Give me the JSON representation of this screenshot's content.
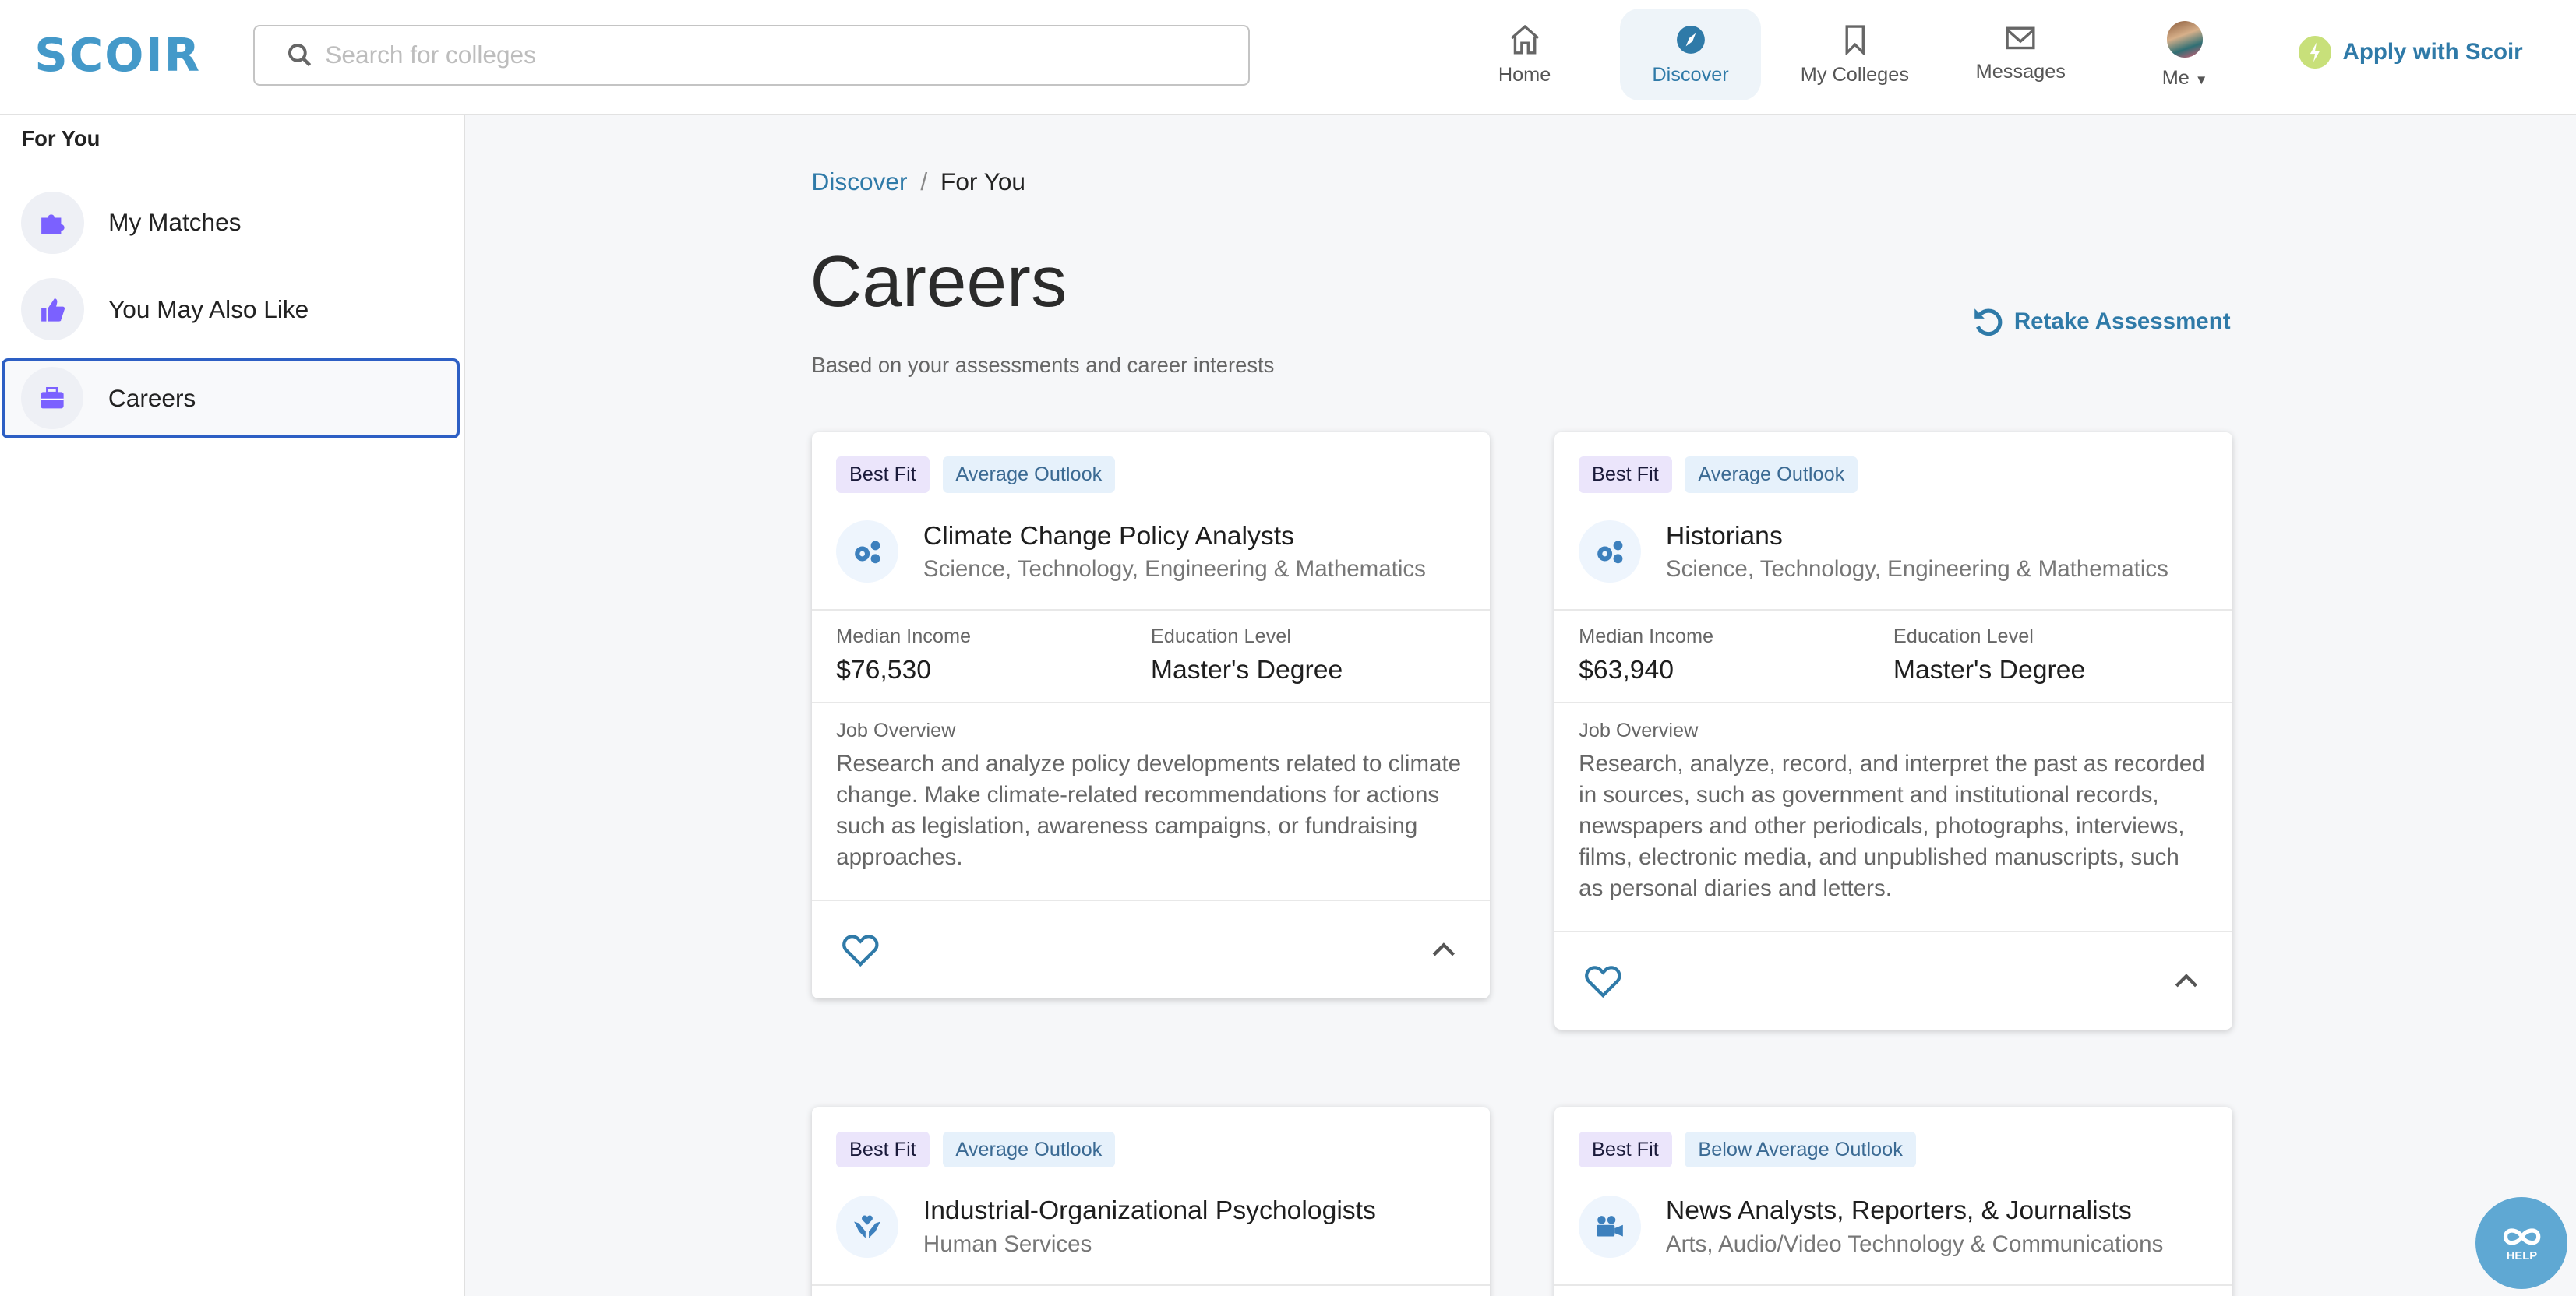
{
  "header": {
    "logo": "SCOIR",
    "search_placeholder": "Search for colleges",
    "nav": [
      {
        "label": "Home",
        "icon": "home-icon"
      },
      {
        "label": "Discover",
        "icon": "compass-icon",
        "active": true
      },
      {
        "label": "My Colleges",
        "icon": "bookmark-icon"
      },
      {
        "label": "Messages",
        "icon": "envelope-icon"
      },
      {
        "label": "Me",
        "icon": "avatar"
      }
    ],
    "apply_label": "Apply with Scoir"
  },
  "sidebar": {
    "title": "For You",
    "items": [
      {
        "label": "My Matches",
        "icon": "puzzle-icon"
      },
      {
        "label": "You May Also Like",
        "icon": "thumbs-up-icon"
      },
      {
        "label": "Careers",
        "icon": "briefcase-icon",
        "selected": true
      }
    ]
  },
  "breadcrumb": {
    "parent": "Discover",
    "separator": "/",
    "current": "For You"
  },
  "page": {
    "title": "Careers",
    "subtitle": "Based on your assessments and career interests",
    "retake_label": "Retake Assessment"
  },
  "labels": {
    "median_income": "Median Income",
    "education_level": "Education Level",
    "job_overview": "Job Overview"
  },
  "cards": [
    {
      "fit": "Best Fit",
      "outlook": "Average Outlook",
      "title": "Climate Change Policy Analysts",
      "category": "Science, Technology, Engineering & Mathematics",
      "icon": "gears-icon",
      "income": "$76,530",
      "education": "Master's Degree",
      "overview": "Research and analyze policy developments related to climate change. Make climate-related recommendations for actions such as legislation, awareness campaigns, or fundraising approaches."
    },
    {
      "fit": "Best Fit",
      "outlook": "Average Outlook",
      "title": "Historians",
      "category": "Science, Technology, Engineering & Mathematics",
      "icon": "gears-icon",
      "income": "$63,940",
      "education": "Master's Degree",
      "overview": "Research, analyze, record, and interpret the past as recorded in sources, such as government and institutional records, newspapers and other periodicals, photographs, interviews, films, electronic media, and unpublished manuscripts, such as personal diaries and letters."
    },
    {
      "fit": "Best Fit",
      "outlook": "Average Outlook",
      "title": "Industrial-Organizational Psychologists",
      "category": "Human Services",
      "icon": "hands-heart-icon"
    },
    {
      "fit": "Best Fit",
      "outlook": "Below Average Outlook",
      "title": "News Analysts, Reporters, & Journalists",
      "category": "Arts, Audio/Video Technology & Communications",
      "icon": "video-camera-icon"
    }
  ],
  "help_label": "HELP",
  "colors": {
    "brand": "#4499c9",
    "accent": "#2f7aa8",
    "selection": "#2d5fc4",
    "apply_icon": "#c8e07a"
  }
}
